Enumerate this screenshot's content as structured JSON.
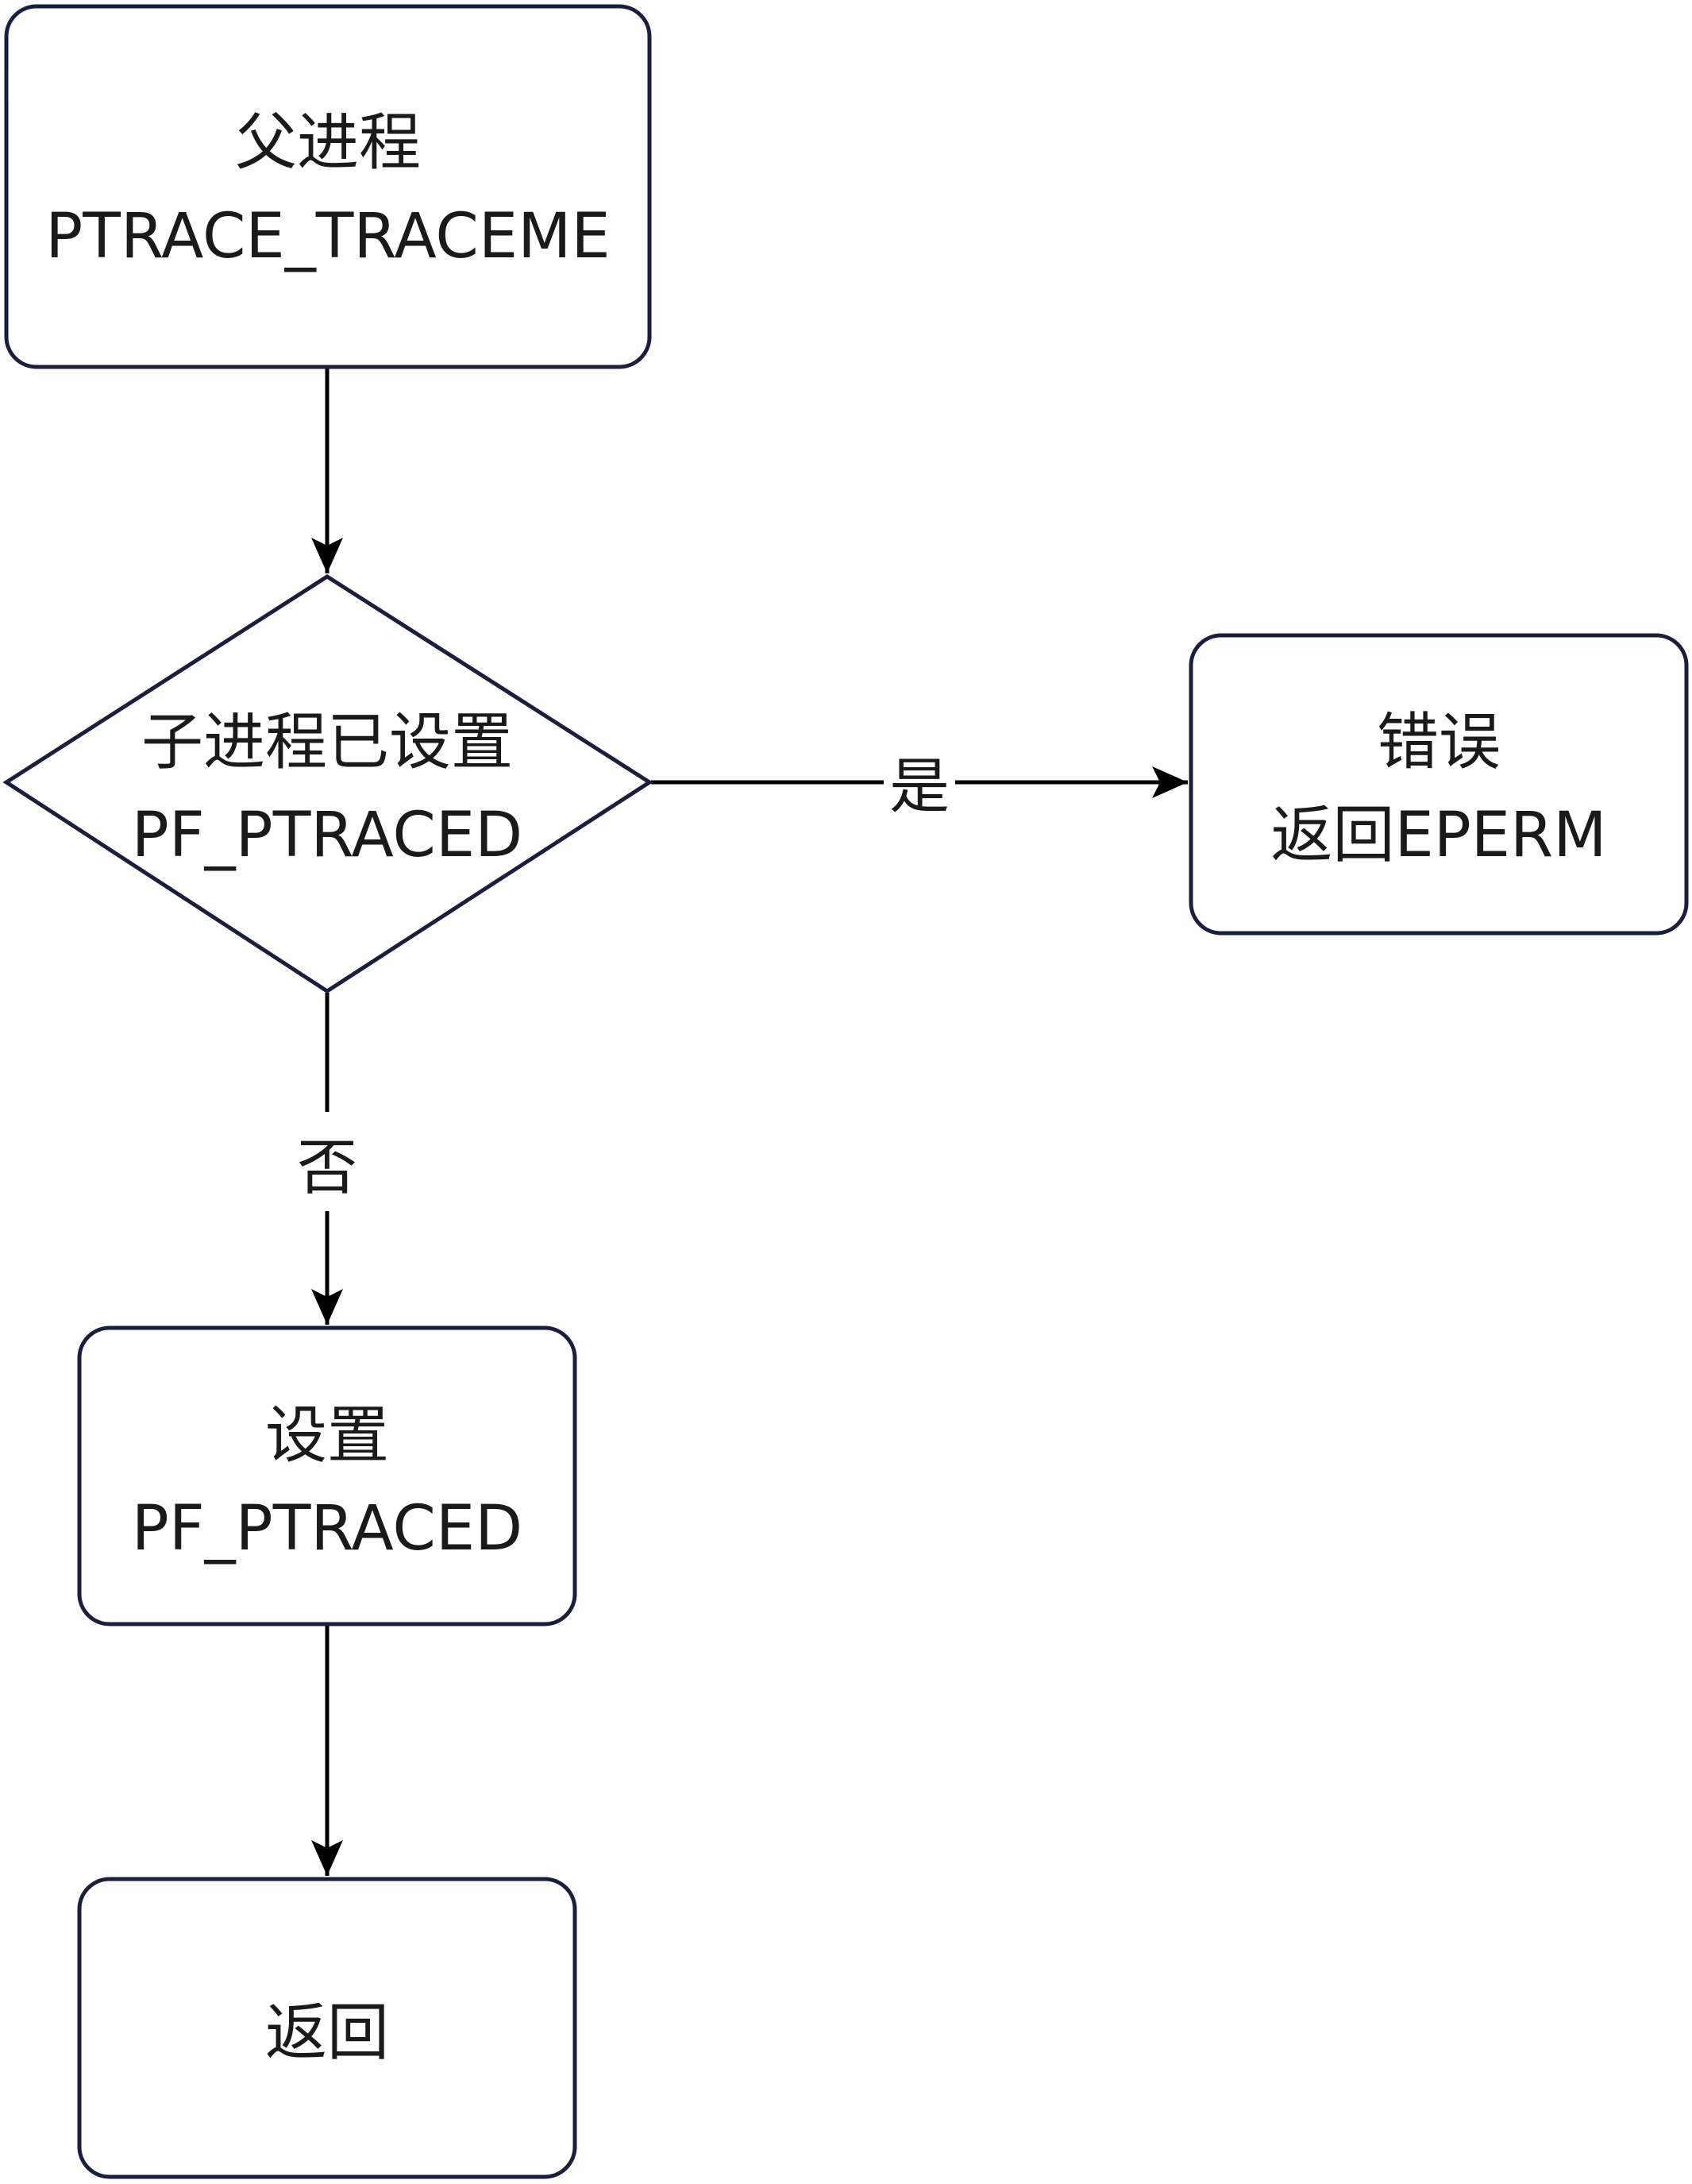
{
  "nodes": {
    "start": {
      "line1": "父进程",
      "line2": "PTRACE_TRACEME"
    },
    "check": {
      "line1": "子进程已设置",
      "line2": "PF_PTRACED"
    },
    "error": {
      "line1": "错误",
      "line2": "返回EPERM"
    },
    "set": {
      "line1": "设置",
      "line2": "PF_PTRACED"
    },
    "end": {
      "line1": "返回"
    }
  },
  "edges": {
    "yes_label": "是",
    "no_label": "否"
  },
  "colors": {
    "node_border": "#1a1f3c",
    "edge": "#000000",
    "text": "#1a1a1a"
  }
}
